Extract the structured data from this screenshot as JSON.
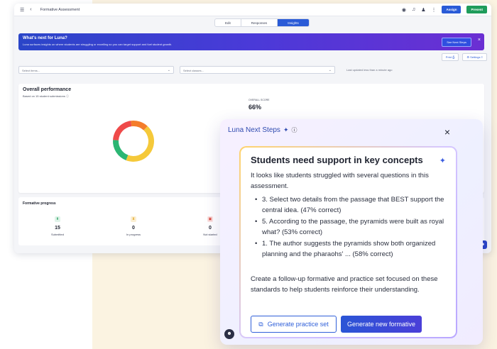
{
  "app": {
    "title": "Formative Assessment",
    "topbar_buttons": {
      "assign": "Assign",
      "present": "Present"
    },
    "tabs": [
      {
        "label": "Edit"
      },
      {
        "label": "Responses"
      },
      {
        "label": "Insights"
      }
    ],
    "banner": {
      "title": "What's next for Luna?",
      "subtitle": "Luna surfaces insights on where students are struggling or excelling so you can target support and fuel student growth.",
      "button": "See Next Steps"
    },
    "toolbar": {
      "print": "Print",
      "settings": "Settings"
    },
    "filters": {
      "items_placeholder": "Select items...",
      "classes_placeholder": "Select classes...",
      "updated": "Last updated less than a minute ago"
    },
    "performance": {
      "title": "Overall performance",
      "subtitle": "Based on 15 student submissions",
      "score_label": "OVERALL SCORE",
      "score_value": "66%"
    },
    "progress": {
      "title": "Formative progress",
      "items": [
        {
          "value": "15",
          "label": "Submitted",
          "color": "#1f9c5b"
        },
        {
          "value": "0",
          "label": "In progress",
          "color": "#e3a21a"
        },
        {
          "value": "0",
          "label": "Not started",
          "color": "#d9453b"
        }
      ]
    }
  },
  "luna": {
    "header": "Luna Next Steps",
    "card": {
      "title": "Students need support in key concepts",
      "intro": "It looks like students struggled with several questions in this assessment.",
      "items": [
        "3. Select two details from the passage that BEST support the central idea. (47% correct)",
        "5. According to the passage, the pyramids were built as royal what? (53% correct)",
        "1. The author suggests the pyramids show both organized planning and the pharaohs' ... (58% correct)"
      ],
      "cta": "Create a follow-up formative and practice set focused on these standards to help students reinforce their understanding.",
      "btn_practice": "Generate practice set",
      "btn_new": "Generate new formative"
    }
  },
  "donut": {
    "segments": [
      {
        "name": "yellow",
        "color": "#f5c93a",
        "value": 0.44
      },
      {
        "name": "green",
        "color": "#2bb673",
        "value": 0.2
      },
      {
        "name": "red",
        "color": "#ef4a4a",
        "value": 0.22
      },
      {
        "name": "orange",
        "color": "#f47d2b",
        "value": 0.14
      }
    ]
  }
}
